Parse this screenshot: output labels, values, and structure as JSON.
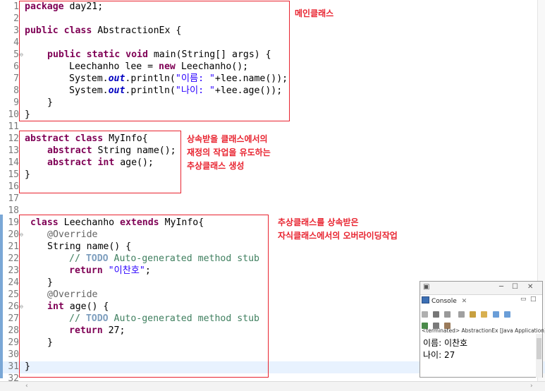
{
  "editor": {
    "lines": [
      {
        "n": "1"
      },
      {
        "n": "2"
      },
      {
        "n": "3"
      },
      {
        "n": "4"
      },
      {
        "n": "5"
      },
      {
        "n": "6"
      },
      {
        "n": "7"
      },
      {
        "n": "8"
      },
      {
        "n": "9"
      },
      {
        "n": "10"
      },
      {
        "n": "11"
      },
      {
        "n": "12"
      },
      {
        "n": "13"
      },
      {
        "n": "14"
      },
      {
        "n": "15"
      },
      {
        "n": "16"
      },
      {
        "n": "17"
      },
      {
        "n": "18"
      },
      {
        "n": "19"
      },
      {
        "n": "20"
      },
      {
        "n": "21"
      },
      {
        "n": "22"
      },
      {
        "n": "23"
      },
      {
        "n": "24"
      },
      {
        "n": "25"
      },
      {
        "n": "26"
      },
      {
        "n": "27"
      },
      {
        "n": "28"
      },
      {
        "n": "29"
      },
      {
        "n": "30"
      },
      {
        "n": "31"
      },
      {
        "n": "32"
      }
    ],
    "code": {
      "l1_kw": "package",
      "l1_rest": " day21;",
      "l3_kw": "public class",
      "l3_rest": " AbstractionEx {",
      "l5_kw": "public static void",
      "l5_rest": " main(String[] args) {",
      "l6_a": "Leechanho lee = ",
      "l6_kw": "new",
      "l6_b": " Leechanho();",
      "l7_a": "System.",
      "l7_fld": "out",
      "l7_b": ".println(",
      "l7_str": "\"이름: \"",
      "l7_c": "+lee.name());",
      "l8_a": "System.",
      "l8_fld": "out",
      "l8_b": ".println(",
      "l8_str": "\"나이: \"",
      "l8_c": "+lee.age());",
      "l9": "}",
      "l10": "}",
      "l12_kw": "abstract class",
      "l12_rest": " MyInfo{",
      "l13_kw": "abstract",
      "l13_rest": " String name();",
      "l14_kw": "abstract int",
      "l14_rest": " age();",
      "l15": "}",
      "l19_kw1": "class",
      "l19_mid": " Leechanho ",
      "l19_kw2": "extends",
      "l19_rest": " MyInfo{",
      "l20_an": "@Override",
      "l21": "String name() {",
      "l22_cm1": "// ",
      "l22_todo": "TODO",
      "l22_cm2": " Auto-generated method stub",
      "l23_kw": "return",
      "l23_str": " \"이찬호\"",
      "l23_rest": ";",
      "l24": "}",
      "l25_an": "@Override",
      "l26_kw": "int",
      "l26_rest": " age() {",
      "l27_cm1": "// ",
      "l27_todo": "TODO",
      "l27_cm2": " Auto-generated method stub",
      "l28_kw": "return",
      "l28_rest": " 27;",
      "l29": "}",
      "l31": "}"
    }
  },
  "annotations": {
    "main_note": "메인클래스",
    "abstract_note": "상속받을 클래스에서의\n재정의 작업을 유도하는\n추상클래스 생성",
    "override_note": "추상클래스를 상속받은\n자식클래스에서의 오버라이딩작업"
  },
  "console": {
    "tab_label": "Console",
    "tab_close": "✕",
    "status": "<terminated> AbstractionEx [Java Application] C:\\",
    "output_line1": "이름: 이찬호",
    "output_line2": "나이: 27"
  },
  "colors": {
    "keyword": "#7f0055",
    "string": "#2a00ff",
    "comment": "#3f7f5f",
    "annotation_red": "#e8232f",
    "current_line": "#e8f2fe"
  }
}
